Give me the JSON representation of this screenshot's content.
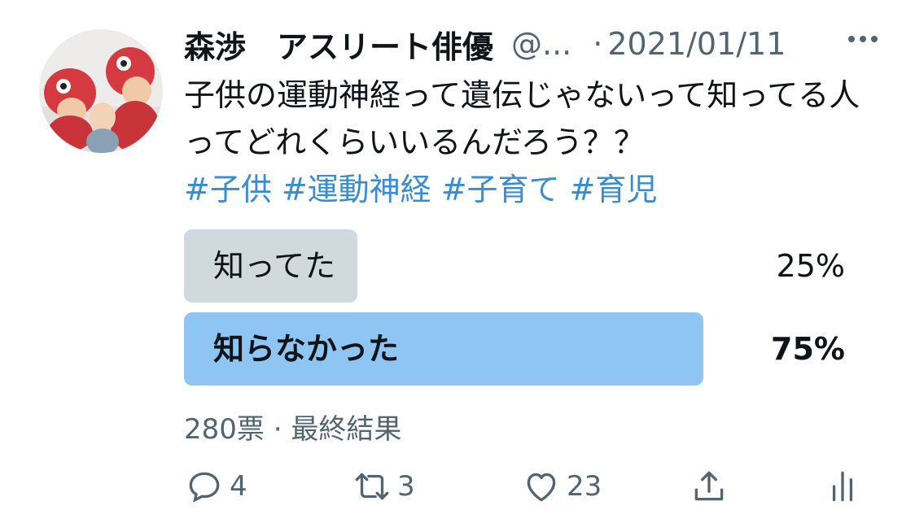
{
  "tweet": {
    "author_name": "森渉　アスリート俳優",
    "handle": "@...",
    "separator": "·",
    "date": "2021/01/11",
    "text": "子供の運動神経って遺伝じゃないって知ってる人ってどれくらいいるんだろう？？",
    "hashtags": [
      "#子供",
      "#運動神経",
      "#子育て",
      "#育児"
    ]
  },
  "poll": {
    "options": [
      {
        "label": "知ってた",
        "percent_text": "25%",
        "percent": 25,
        "winner": false,
        "color": "#cfd9de"
      },
      {
        "label": "知らなかった",
        "percent_text": "75%",
        "percent": 75,
        "winner": true,
        "color": "#8ec5f2"
      }
    ],
    "meta": "280票 · 最終結果"
  },
  "actions": {
    "reply": {
      "icon": "reply-icon",
      "count": "4"
    },
    "retweet": {
      "icon": "retweet-icon",
      "count": "3"
    },
    "like": {
      "icon": "heart-icon",
      "count": "23"
    },
    "share": {
      "icon": "share-icon"
    },
    "analytics": {
      "icon": "analytics-icon"
    }
  },
  "colors": {
    "text": "#0f1419",
    "secondary": "#536471",
    "hashtag": "#3b8ccf"
  }
}
